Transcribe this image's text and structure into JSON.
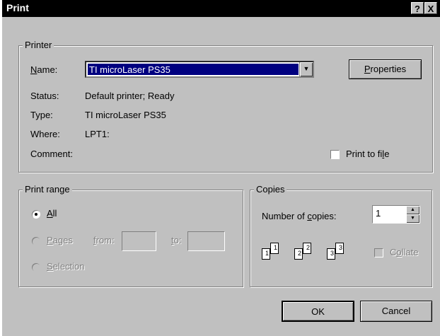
{
  "window": {
    "title": "Print",
    "help_label": "?",
    "close_label": "X"
  },
  "printer": {
    "group_label": "Printer",
    "name_label_prefix": "",
    "name_label_key": "N",
    "name_label_rest": "ame:",
    "name_value": "TI microLaser PS35",
    "properties_key": "P",
    "properties_rest": "roperties",
    "status_label": "Status:",
    "status_value": "Default printer; Ready",
    "type_label": "Type:",
    "type_value": "TI microLaser PS35",
    "where_label": "Where:",
    "where_value": "LPT1:",
    "comment_label": "Comment:",
    "print_to_file_prefix": "Print to fi",
    "print_to_file_key": "l",
    "print_to_file_rest": "e"
  },
  "print_range": {
    "group_label": "Print range",
    "all_key": "A",
    "all_rest": "ll",
    "pages_key": "P",
    "pages_rest": "ages",
    "from_key": "f",
    "from_rest": "rom:",
    "to_key": "t",
    "to_rest": "o:",
    "selection_key": "S",
    "selection_rest": "election"
  },
  "copies": {
    "group_label": "Copies",
    "number_prefix": "Number of ",
    "number_key": "c",
    "number_rest": "opies:",
    "number_value": "1",
    "collate_prefix": "C",
    "collate_key": "o",
    "collate_rest": "llate",
    "page_icons": [
      "1",
      "1",
      "2",
      "2",
      "3",
      "3"
    ]
  },
  "buttons": {
    "ok": "OK",
    "cancel": "Cancel"
  }
}
